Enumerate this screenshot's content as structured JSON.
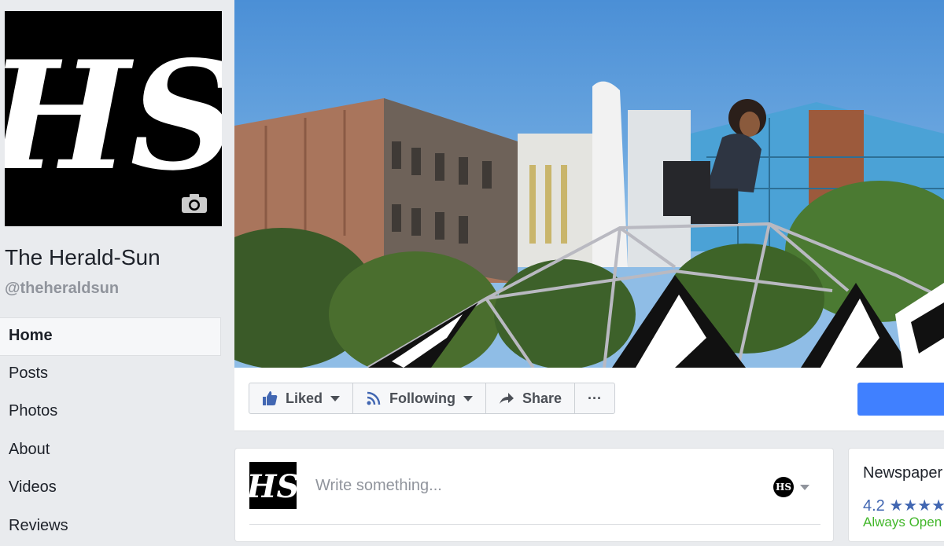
{
  "page": {
    "name": "The Herald-Sun",
    "handle": "@theheraldsun",
    "logo_text": "HS"
  },
  "sidebar": {
    "items": [
      {
        "label": "Home",
        "active": true
      },
      {
        "label": "Posts"
      },
      {
        "label": "Photos"
      },
      {
        "label": "About"
      },
      {
        "label": "Videos"
      },
      {
        "label": "Reviews"
      }
    ]
  },
  "actions": {
    "liked": "Liked",
    "following": "Following",
    "share": "Share",
    "more": "···"
  },
  "composer": {
    "placeholder": "Write something..."
  },
  "info": {
    "category": "Newspaper",
    "rating": "4.2 ★★★★",
    "status": "Always Open"
  },
  "colors": {
    "accent": "#4080ff",
    "brand": "#4267b2",
    "open": "#42b72a",
    "background": "#e9ebee"
  },
  "icons": {
    "liked": "thumbs-up-icon",
    "following": "rss-icon",
    "share": "share-arrow-icon",
    "camera": "camera-icon"
  }
}
